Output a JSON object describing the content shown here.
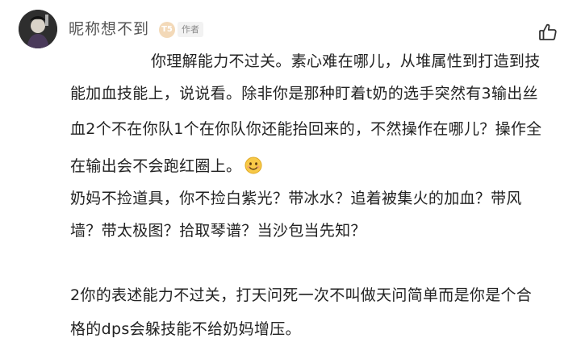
{
  "comment": {
    "username": "昵称想不到",
    "level_badge": "T5",
    "author_tag": "作者",
    "icons": {
      "avatar": "avatar",
      "like": "thumbs-up-icon",
      "emoji": "smile-emoji-icon"
    },
    "lines": [
      "你理解能力不过关。素心难在哪儿，从堆属性到打造到技",
      "能加血技能上，说说看。除非你是那种盯着t奶的选手突然有3输出丝",
      "血2个不在你队1个在你队你还能抬回来的，不然操作在哪儿？操作全",
      "在输出会不会跑红圈上。",
      "奶妈不捡道具，你不捡白紫光？带冰水？追着被集火的加血？带风",
      "墙？带太极图？拾取琴谱？当沙包当先知？",
      "2你的表述能力不过关，打天问死一次不叫做天问简单而是你是个合",
      "格的dps会躲技能不给奶妈增压。"
    ]
  }
}
